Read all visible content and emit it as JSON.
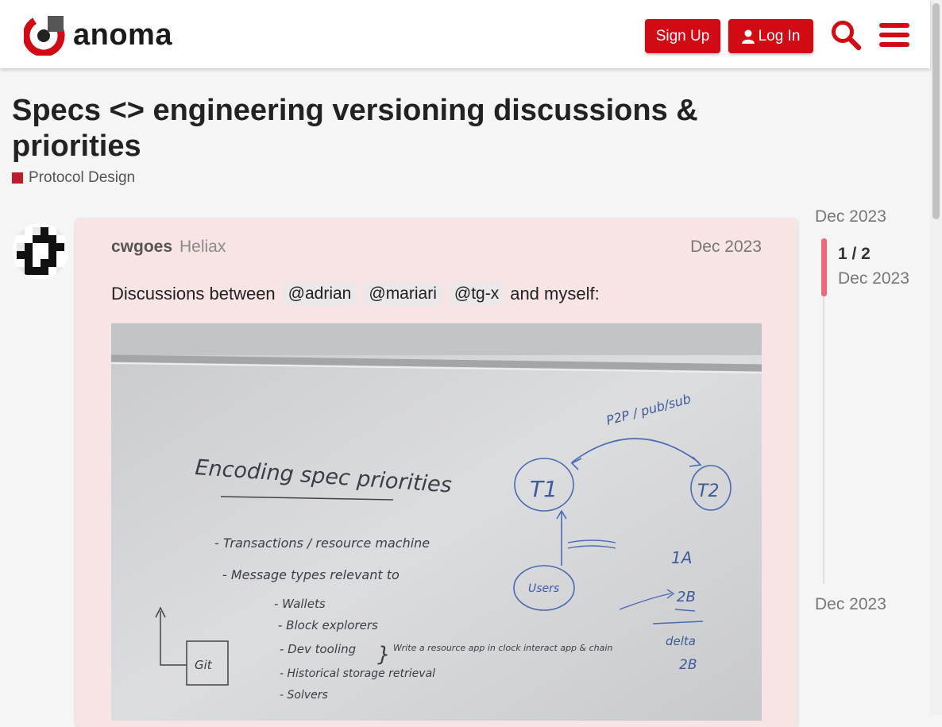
{
  "header": {
    "logo_text": "anoma",
    "signup_label": "Sign Up",
    "login_label": "Log In",
    "brand_color": "#d20a13"
  },
  "topic": {
    "title": "Specs <> engineering versioning discussions & priorities",
    "category": "Protocol Design",
    "category_color": "#bc1c2c"
  },
  "post": {
    "username": "cwgoes",
    "user_title": "Heliax",
    "date": "Dec 2023",
    "text_prefix": "Discussions between",
    "mentions": [
      "@adrian",
      "@mariari",
      "@tg-x"
    ],
    "text_suffix": "and myself:",
    "image": {
      "heading": "Encoding spec priorities",
      "items": [
        "- Transactions / resource machine",
        "- Message types relevant to",
        "- Wallets",
        "- Block explorers",
        "- Dev tooling",
        "- Historical storage retrieval",
        "- Solvers"
      ],
      "note": "Write a resource app in clock interact app & chain",
      "bracket": "}",
      "box_label": "Git",
      "node_t1": "T1",
      "node_t2": "T2",
      "node_users": "Users",
      "arrow_label": "P2P / pub/sub",
      "right_1a": "1A",
      "right_2b": "2B",
      "right_delta": "delta",
      "right_2b_b": "2B"
    }
  },
  "timeline": {
    "start_date": "Dec 2023",
    "position": "1 / 2",
    "position_date": "Dec 2023",
    "end_date": "Dec 2023",
    "accent_color": "#ee6a7a"
  }
}
